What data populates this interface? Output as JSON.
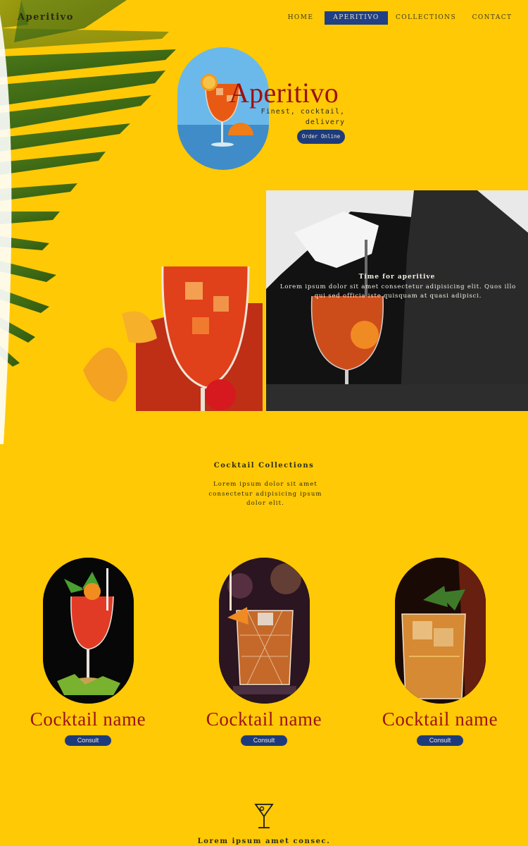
{
  "brand": {
    "name": "Aperitivo"
  },
  "nav": {
    "items": [
      {
        "label": "HOME"
      },
      {
        "label": "APERITIVO"
      },
      {
        "label": "COLLECTIONS"
      },
      {
        "label": "CONTACT"
      }
    ],
    "active": "APERITIVO"
  },
  "hero": {
    "title": "Aperitivo",
    "subtitle_line1": "Finest, cocktail,",
    "subtitle_line2": "delivery",
    "order_button": "Order Online"
  },
  "banner": {
    "title": "Time for aperitive",
    "body": "Lorem ipsum dolor sit amet consectetur adipisicing elit. Quos illo qui sed officia iste quisquam at quasi adipisci."
  },
  "collections": {
    "title": "Cocktail Collections",
    "description": "Lorem ipsum dolor sit amet consectetur adipisicing ipsum dolor elit.",
    "cards": [
      {
        "name": "Cocktail name",
        "button": "Consult",
        "image": "spritz-cocktail"
      },
      {
        "name": "Cocktail name",
        "button": "Consult",
        "image": "negroni-cocktail"
      },
      {
        "name": "Cocktail name",
        "button": "Consult",
        "image": "whiskey-cocktail"
      }
    ]
  },
  "footer": {
    "icon": "cocktail-glass-icon",
    "text": "Lorem ipsum amet consec."
  },
  "colors": {
    "background": "#ffc906",
    "accent_blue": "#1d3b7c",
    "accent_red": "#9c1111"
  }
}
